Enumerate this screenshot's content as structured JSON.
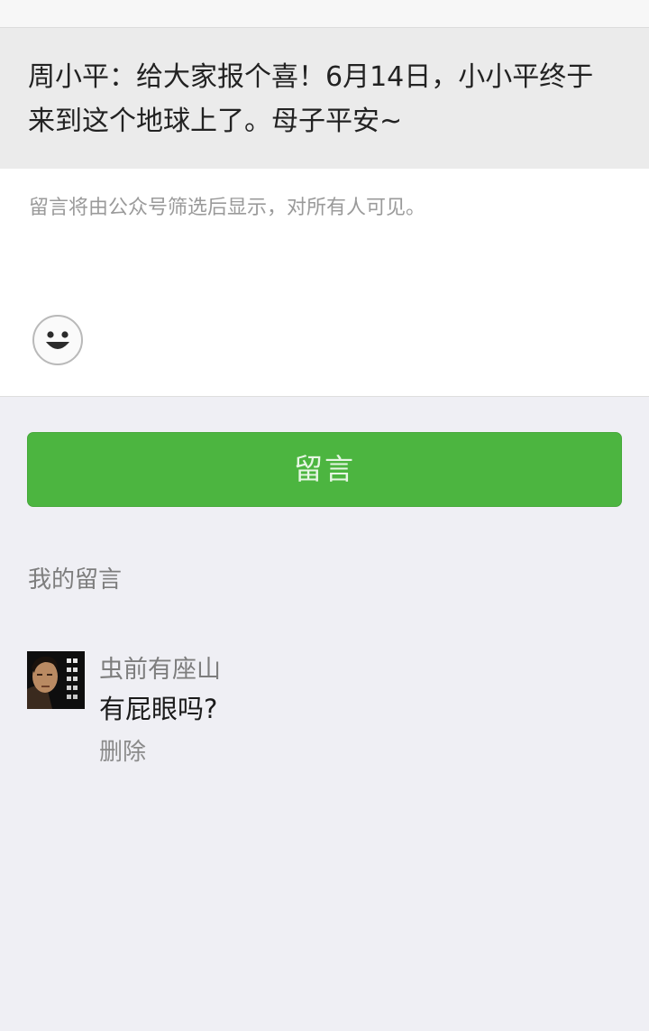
{
  "article": {
    "title": "周小平：给大家报个喜！6月14日，小小平终于来到这个地球上了。母子平安~"
  },
  "comment_box": {
    "placeholder": "留言将由公众号筛选后显示，对所有人可见。",
    "emoji_icon": "smiley-face-icon"
  },
  "submit": {
    "label": "留言"
  },
  "my_comments": {
    "section_label": "我的留言",
    "items": [
      {
        "name": "虫前有座山",
        "text": "有屁眼吗?",
        "delete_label": "删除",
        "avatar_icon": "user-avatar"
      }
    ]
  },
  "colors": {
    "accent": "#4cb540",
    "background": "#efeff4",
    "title_background": "#ebebeb"
  }
}
